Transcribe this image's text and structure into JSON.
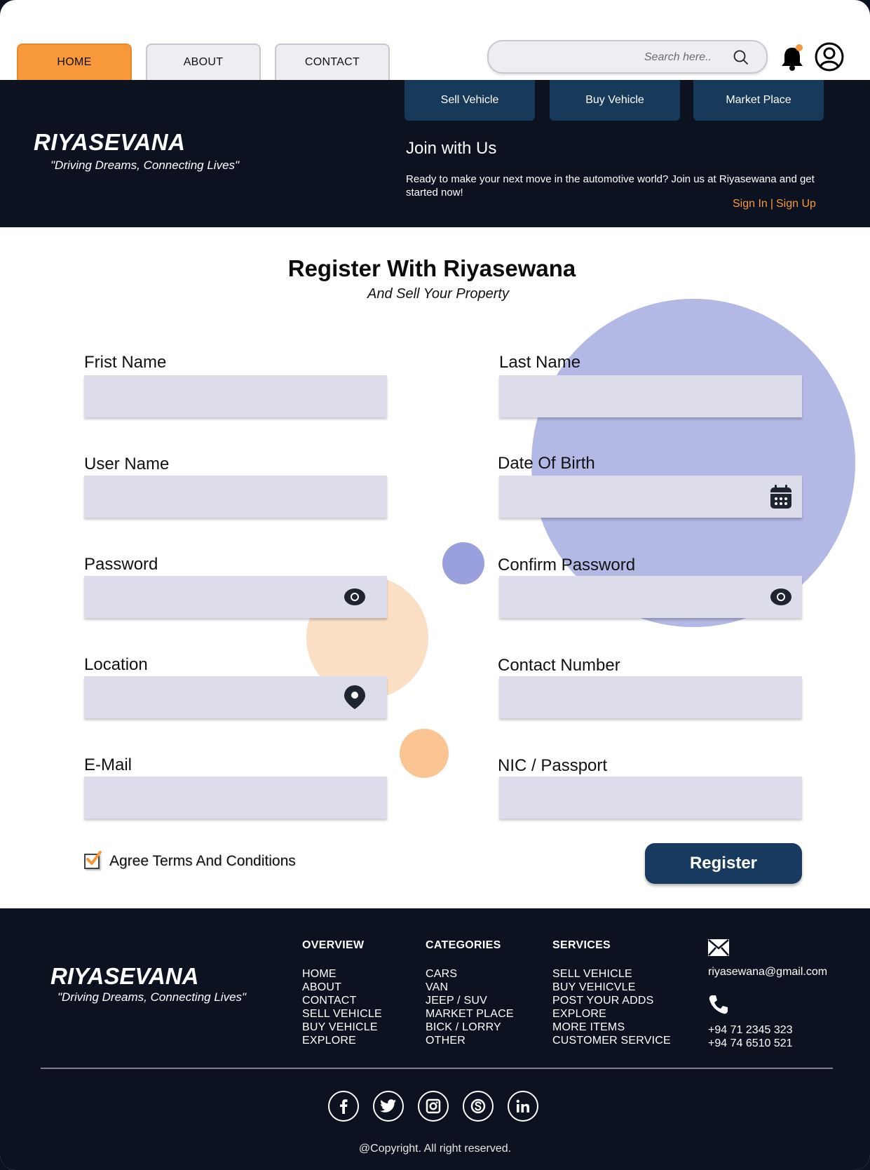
{
  "nav": {
    "tabs": [
      {
        "label": "HOME",
        "active": true
      },
      {
        "label": "ABOUT",
        "active": false
      },
      {
        "label": "CONTACT",
        "active": false
      }
    ],
    "search_placeholder": "Search here.."
  },
  "header": {
    "brand": "RIYASEVANA",
    "tagline": "\"Driving Dreams, Connecting Lives\"",
    "quick_links": [
      "Sell Vehicle",
      "Buy Vehicle",
      "Market Place"
    ],
    "join_title": "Join with Us",
    "join_text": "Ready to make your next move in the automotive world? Join us at Riyasewana and get started now!",
    "sign_in": "Sign In",
    "separator": "|",
    "sign_up": "Sign Up"
  },
  "form": {
    "title": "Register With Riyasewana",
    "subtitle": "And Sell Your Property",
    "fields": {
      "first_name": "Frist Name",
      "last_name": "Last Name",
      "user_name": "User Name",
      "dob": "Date Of Birth",
      "password": "Password",
      "confirm_password": "Confirm Password",
      "location": "Location",
      "contact_number": "Contact Number",
      "email": "E-Mail",
      "nic": "NIC / Passport"
    },
    "agree_label": "Agree Terms And Conditions",
    "agree_checked": true,
    "register_label": "Register"
  },
  "footer": {
    "brand": "RIYASEVANA",
    "tagline": "\"Driving Dreams, Connecting Lives\"",
    "columns": [
      {
        "title": "OVERVIEW",
        "items": [
          "HOME",
          "ABOUT",
          "CONTACT",
          "SELL VEHICLE",
          "BUY VEHICLE",
          "EXPLORE"
        ]
      },
      {
        "title": "CATEGORIES",
        "items": [
          "CARS",
          "VAN",
          "JEEP / SUV",
          "MARKET PLACE",
          "BICK / LORRY",
          "OTHER"
        ]
      },
      {
        "title": "SERVICES",
        "items": [
          "SELL VEHICLE",
          "BUY VEHICVLE",
          "POST YOUR ADDS",
          "EXPLORE",
          "MORE ITEMS",
          "CUSTOMER SERVICE"
        ]
      }
    ],
    "email": "riyasewana@gmail.com",
    "phones": [
      "+94 71 2345 323",
      "+94 74 6510 521"
    ],
    "socials": [
      "facebook-icon",
      "twitter-icon",
      "instagram-icon",
      "skype-icon",
      "linkedin-icon"
    ],
    "copyright": "@Copyright. All right reserved."
  },
  "colors": {
    "accent": "#f7993b",
    "navy": "#0c1220",
    "button": "#173a5e",
    "field": "#dcdcea",
    "circle_lavender": "#b3b8e4"
  }
}
